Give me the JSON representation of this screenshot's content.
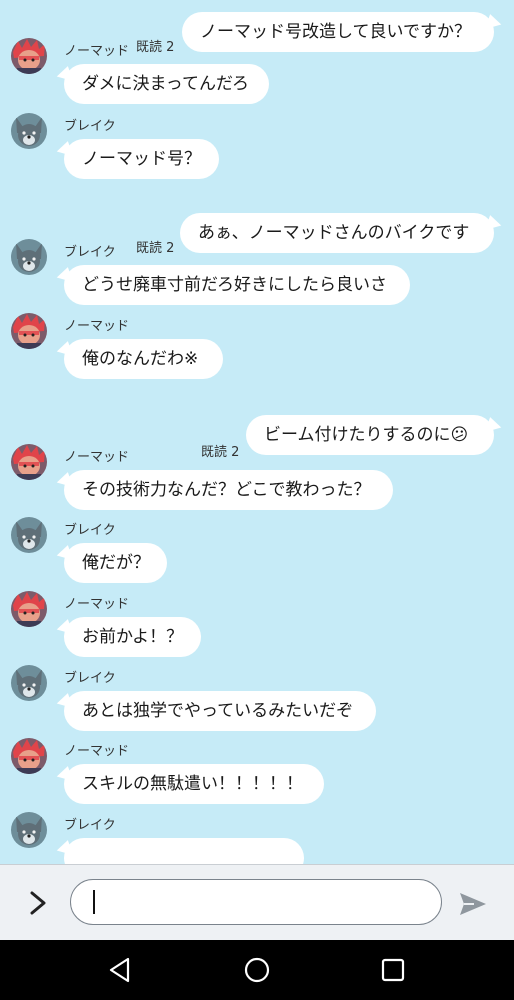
{
  "chat": {
    "messages": [
      {
        "dir": "out",
        "text": "ノーマッド号改造して良いですか？",
        "read": "既読 2"
      },
      {
        "dir": "in",
        "sender": "ノーマッド",
        "avatar": "nomad",
        "text": "ダメに決まってんだろ"
      },
      {
        "dir": "in",
        "sender": "ブレイク",
        "avatar": "blake",
        "text": "ノーマッド号？"
      },
      {
        "dir": "out",
        "text": "あぁ、ノーマッドさんのバイクです",
        "read": "既読 2"
      },
      {
        "dir": "in",
        "sender": "ブレイク",
        "avatar": "blake",
        "text": "どうせ廃車寸前だろ好きにしたら良いさ"
      },
      {
        "dir": "in",
        "sender": "ノーマッド",
        "avatar": "nomad",
        "text": "俺のなんだわ※"
      },
      {
        "dir": "out",
        "text": "ビーム付けたりするのに😕",
        "read": "既読 2"
      },
      {
        "dir": "in",
        "sender": "ノーマッド",
        "avatar": "nomad",
        "text": "その技術力なんだ？どこで教わった？"
      },
      {
        "dir": "in",
        "sender": "ブレイク",
        "avatar": "blake",
        "text": "俺だが？"
      },
      {
        "dir": "in",
        "sender": "ノーマッド",
        "avatar": "nomad",
        "text": "お前かよ！？"
      },
      {
        "dir": "in",
        "sender": "ブレイク",
        "avatar": "blake",
        "text": "あとは独学でやっているみたいだぞ"
      },
      {
        "dir": "in",
        "sender": "ノーマッド",
        "avatar": "nomad",
        "text": "スキルの無駄遣い！！！！！"
      },
      {
        "dir": "in",
        "sender": "ブレイク",
        "avatar": "blake",
        "text": ""
      }
    ]
  },
  "composer": {
    "expand_icon": "chevron-right-icon",
    "input_value": "",
    "send_icon": "send-icon"
  },
  "navbar": {
    "back_icon": "back-triangle-icon",
    "home_icon": "home-circle-icon",
    "recents_icon": "recents-square-icon"
  },
  "colors": {
    "background": "#c6ebf7",
    "bubble": "#ffffff",
    "nomad_hair": "#e0444a",
    "blake_fur": "#5f6f78"
  }
}
